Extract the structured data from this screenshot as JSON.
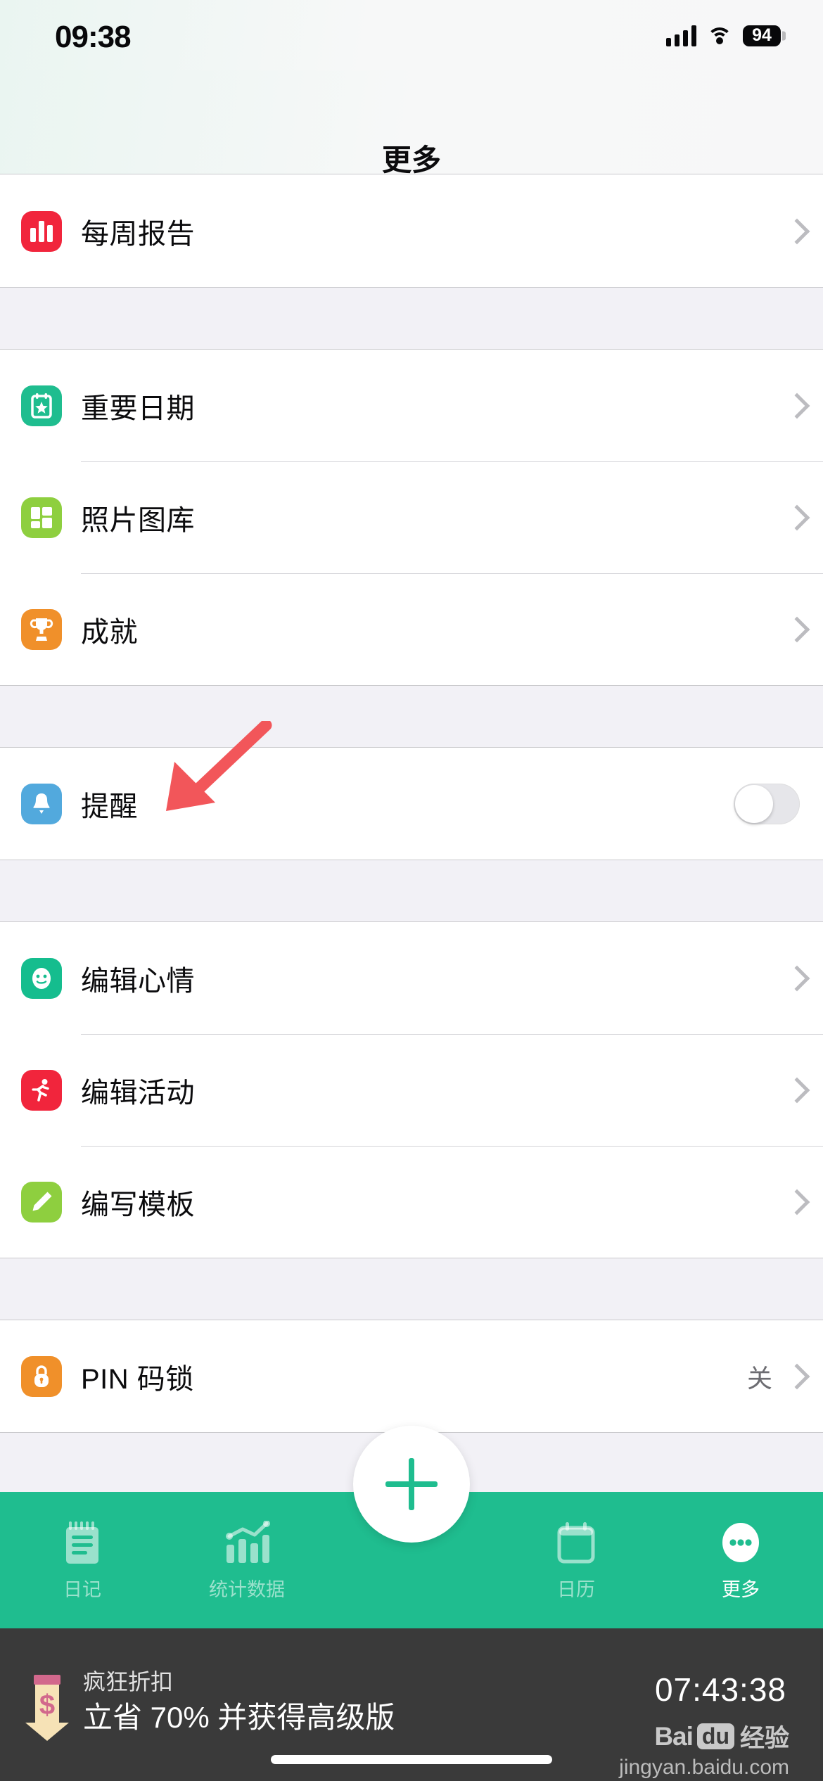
{
  "status_bar": {
    "time": "09:38",
    "battery": "94",
    "signal_icon": "cellular-bars-icon",
    "wifi_icon": "wifi-icon",
    "battery_icon": "battery-icon"
  },
  "header": {
    "title": "更多"
  },
  "sections": [
    {
      "id": "reports",
      "rows": [
        {
          "label": "每周报告",
          "icon": "bar-chart-icon",
          "icon_color": "#f1253c",
          "accessory": "chevron",
          "value": ""
        }
      ]
    },
    {
      "id": "content",
      "rows": [
        {
          "label": "重要日期",
          "icon": "calendar-star-icon",
          "icon_color": "#1fbd8f",
          "accessory": "chevron",
          "value": ""
        },
        {
          "label": "照片图库",
          "icon": "photo-grid-icon",
          "icon_color": "#8ecf3f",
          "accessory": "chevron",
          "value": ""
        },
        {
          "label": "成就",
          "icon": "trophy-icon",
          "icon_color": "#f0902a",
          "accessory": "chevron",
          "value": ""
        }
      ]
    },
    {
      "id": "reminders",
      "rows": [
        {
          "label": "提醒",
          "icon": "bell-icon",
          "icon_color": "#52a9dd",
          "accessory": "toggle",
          "toggle_on": false,
          "value": ""
        }
      ]
    },
    {
      "id": "editors",
      "rows": [
        {
          "label": "编辑心情",
          "icon": "smiley-icon",
          "icon_color": "#15bd8e",
          "accessory": "chevron",
          "value": ""
        },
        {
          "label": "编辑活动",
          "icon": "runner-icon",
          "icon_color": "#f1253c",
          "accessory": "chevron",
          "value": ""
        },
        {
          "label": "编写模板",
          "icon": "pencil-icon",
          "icon_color": "#8ecf3f",
          "accessory": "chevron",
          "value": ""
        }
      ]
    },
    {
      "id": "security",
      "rows": [
        {
          "label": "PIN 码锁",
          "icon": "lock-icon",
          "icon_color": "#f0902a",
          "accessory": "chevron",
          "value": "关"
        }
      ]
    }
  ],
  "annotation": {
    "arrow_icon": "red-arrow-icon",
    "arrow_color": "#f2565a"
  },
  "tab_bar": {
    "background_color": "#1fbd8f",
    "add_button_icon": "plus-icon",
    "tabs": [
      {
        "label": "日记",
        "icon": "notebook-icon",
        "active": false
      },
      {
        "label": "统计数据",
        "icon": "stats-chart-icon",
        "active": false
      },
      {
        "label": "日历",
        "icon": "calendar-icon",
        "active": false
      },
      {
        "label": "更多",
        "icon": "ellipsis-icon",
        "active": true
      }
    ]
  },
  "promo": {
    "icon": "discount-arrow-icon",
    "title": "疯狂折扣",
    "subtitle": "立省 70% 并获得高级版",
    "timer": "07:43:38",
    "background_color": "#3a3a3a"
  },
  "watermark": {
    "brand_bai": "Bai",
    "brand_du": "du",
    "brand_suffix": "经验",
    "url": "jingyan.baidu.com"
  }
}
